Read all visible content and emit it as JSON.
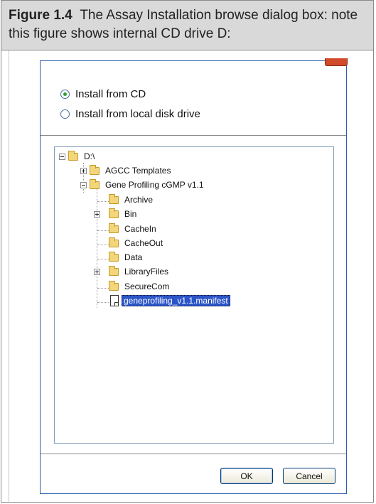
{
  "caption": {
    "figure_label": "Figure 1.4",
    "text": "The Assay Installation browse dialog box: note this figure shows internal CD drive D:"
  },
  "dialog": {
    "options": {
      "install_cd": "Install from CD",
      "install_local": "Install from local disk drive",
      "selected": "install_cd"
    },
    "tree": {
      "root": "D:\\",
      "items": [
        {
          "label": "AGCC Templates",
          "expander": "plus",
          "icon": "folder-icon"
        },
        {
          "label": "Gene Profiling cGMP v1.1",
          "expander": "minus",
          "icon": "folder-icon"
        },
        {
          "label": "Archive",
          "expander": "none",
          "icon": "folder-icon"
        },
        {
          "label": "Bin",
          "expander": "plus",
          "icon": "folder-icon"
        },
        {
          "label": "CacheIn",
          "expander": "none",
          "icon": "folder-icon"
        },
        {
          "label": "CacheOut",
          "expander": "none",
          "icon": "folder-icon"
        },
        {
          "label": "Data",
          "expander": "none",
          "icon": "folder-icon"
        },
        {
          "label": "LibraryFiles",
          "expander": "plus",
          "icon": "folder-icon"
        },
        {
          "label": "SecureCom",
          "expander": "none",
          "icon": "folder-icon"
        },
        {
          "label": "geneprofiling_v1.1.manifest",
          "expander": "none",
          "icon": "file-icon",
          "selected": true
        }
      ]
    },
    "buttons": {
      "ok": "OK",
      "cancel": "Cancel"
    }
  },
  "colors": {
    "caption_bg": "#d9d9d9",
    "dialog_border": "#2c5cae",
    "selection": "#2b55c9",
    "folder": "#f3d57a",
    "radio_dot": "#2f9d2f"
  }
}
